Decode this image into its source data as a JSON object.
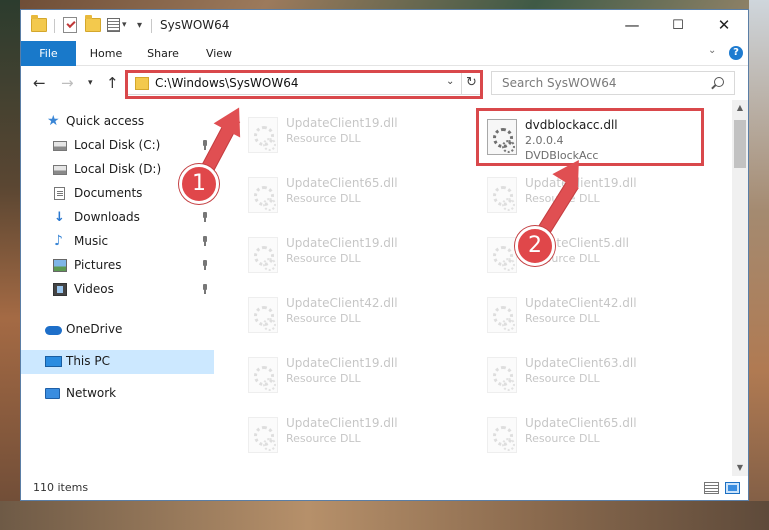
{
  "window": {
    "title": "SysWOW64"
  },
  "titlebar": {
    "minimize": "—",
    "maximize": "☐",
    "close": "✕"
  },
  "ribbon": {
    "tabs": [
      "File",
      "Home",
      "Share",
      "View"
    ],
    "help": "?"
  },
  "address": {
    "path": "C:\\Windows\\SysWOW64"
  },
  "search": {
    "placeholder": "Search SysWOW64"
  },
  "sidebar": {
    "items": [
      {
        "label": "Quick access",
        "icon": "star-icon"
      },
      {
        "label": "Local Disk (C:)",
        "icon": "disk-icon",
        "pinned": true
      },
      {
        "label": "Local Disk (D:)",
        "icon": "disk-icon"
      },
      {
        "label": "Documents",
        "icon": "documents-icon"
      },
      {
        "label": "Downloads",
        "icon": "downloads-icon",
        "pinned": true
      },
      {
        "label": "Music",
        "icon": "music-icon",
        "pinned": true
      },
      {
        "label": "Pictures",
        "icon": "pictures-icon",
        "pinned": true
      },
      {
        "label": "Videos",
        "icon": "videos-icon",
        "pinned": true
      },
      {
        "label": "OneDrive",
        "icon": "cloud-icon"
      },
      {
        "label": "This PC",
        "icon": "computer-icon",
        "selected": true
      },
      {
        "label": "Network",
        "icon": "network-icon"
      }
    ]
  },
  "files": {
    "left": [
      {
        "name": "UpdateClient19.dll",
        "type": "Resource DLL"
      },
      {
        "name": "UpdateClient65.dll",
        "type": "Resource DLL"
      },
      {
        "name": "UpdateClient19.dll",
        "type": "Resource DLL"
      },
      {
        "name": "UpdateClient42.dll",
        "type": "Resource DLL"
      },
      {
        "name": "UpdateClient19.dll",
        "type": "Resource DLL"
      },
      {
        "name": "UpdateClient19.dll",
        "type": "Resource DLL"
      }
    ],
    "highlighted": {
      "name": "dvdblockacc.dll",
      "version": "2.0.0.4",
      "description": "DVDBlockAcc"
    },
    "right": [
      {
        "name": "UpdateClient19.dll",
        "type": "Resource DLL"
      },
      {
        "name": "UpdateClient5.dll",
        "type": "Resource DLL"
      },
      {
        "name": "UpdateClient42.dll",
        "type": "Resource DLL"
      },
      {
        "name": "UpdateClient63.dll",
        "type": "Resource DLL"
      },
      {
        "name": "UpdateClient65.dll",
        "type": "Resource DLL"
      }
    ]
  },
  "status": {
    "count": "110 items"
  },
  "annotations": {
    "step1": "1",
    "step2": "2",
    "color": "#d9484b"
  }
}
